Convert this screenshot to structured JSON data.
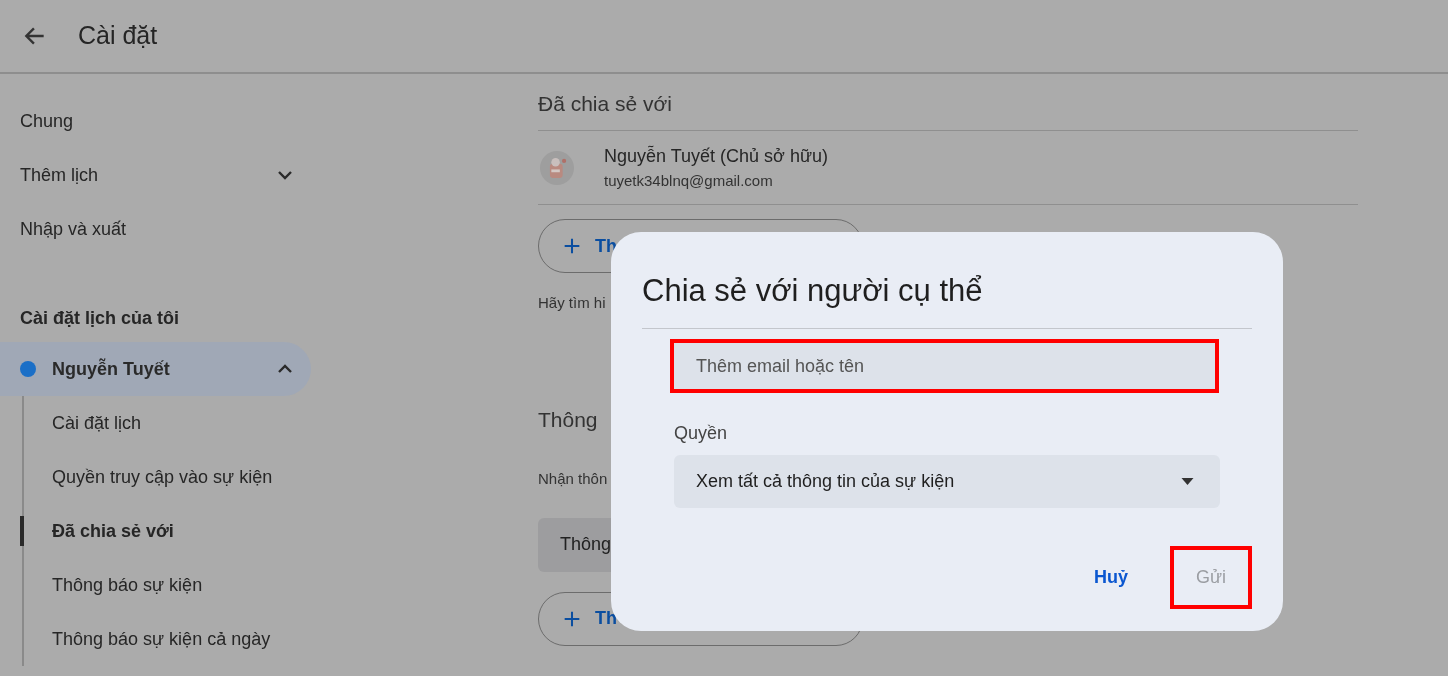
{
  "header": {
    "title": "Cài đặt"
  },
  "sidebar": {
    "items": [
      {
        "label": "Chung",
        "kind": "link"
      },
      {
        "label": "Thêm lịch",
        "kind": "expandable",
        "expanded": false
      },
      {
        "label": "Nhập và xuất",
        "kind": "link"
      }
    ],
    "section_title": "Cài đặt lịch của tôi",
    "calendars": [
      {
        "name": "Nguyễn Tuyết",
        "color": "#1b6fc7",
        "selected": true,
        "expanded": true,
        "children": [
          {
            "label": "Cài đặt lịch",
            "selected": false
          },
          {
            "label": "Quyền truy cập vào sự kiện",
            "selected": false
          },
          {
            "label": "Đã chia sẻ với",
            "selected": true
          },
          {
            "label": "Thông báo sự kiện",
            "selected": false
          },
          {
            "label": "Thông báo sự kiện cả ngày",
            "selected": false
          }
        ]
      }
    ]
  },
  "main": {
    "shared_heading": "Đã chia sẻ với",
    "people": [
      {
        "name": "Nguyễn Tuyết (Chủ sở hữu)",
        "email": "tuyetk34blnq@gmail.com"
      }
    ],
    "add_people_button": "Th",
    "learn_more": "Hãy tìm hi",
    "notify_heading": "Thông",
    "notify_text": "Nhận thôn",
    "notify_select": "Thông",
    "add_notification_button": "Th"
  },
  "dialog": {
    "title": "Chia sẻ với người cụ thể",
    "email_field": {
      "placeholder": "Thêm email hoặc tên",
      "highlighted": true
    },
    "permission_label": "Quyền",
    "permission_value": "Xem tất cả thông tin của sự kiện",
    "buttons": [
      {
        "label": "Huỷ",
        "disabled": false,
        "highlighted": false
      },
      {
        "label": "Gửi",
        "disabled": true,
        "highlighted": true
      }
    ]
  }
}
